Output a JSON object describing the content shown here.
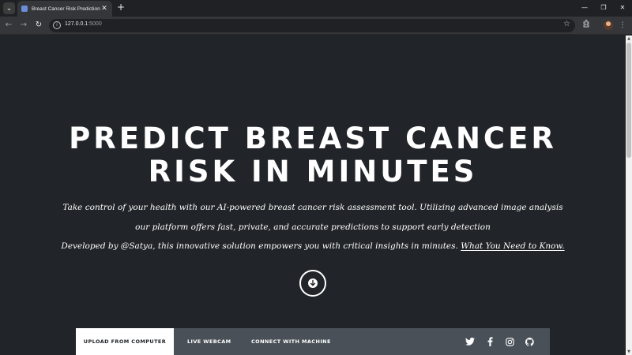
{
  "browser": {
    "tab_title": "Breast Cancer Risk Prediction",
    "url_host": "127.0.0.1",
    "url_port": ":5000",
    "new_tab": "+",
    "tab_close": "✕",
    "window_controls": {
      "minimize": "—",
      "restore": "❐",
      "close": "✕"
    }
  },
  "hero": {
    "title_line1": "PREDICT BREAST CANCER",
    "title_line2": "RISK IN MINUTES",
    "line1": "Take control of your health with our AI-powered breast cancer risk assessment tool. Utilizing advanced image analysis",
    "line2": "our platform offers fast, private, and accurate predictions to support early detection",
    "line3_prefix": "Developed by @Satya, this innovative solution empowers you with critical insights in minutes. ",
    "line3_link": "What You Need to Know."
  },
  "nav": {
    "upload": "UPLOAD FROM COMPUTER",
    "webcam": "LIVE WEBCAM",
    "machine": "CONNECT WITH MACHINE"
  },
  "social_icons": [
    "twitter-icon",
    "facebook-icon",
    "instagram-icon",
    "github-icon"
  ],
  "colors": {
    "page_bg": "#212529",
    "nav_bg": "#495057",
    "active_tab_bg": "#ffffff",
    "text": "#ffffff"
  }
}
